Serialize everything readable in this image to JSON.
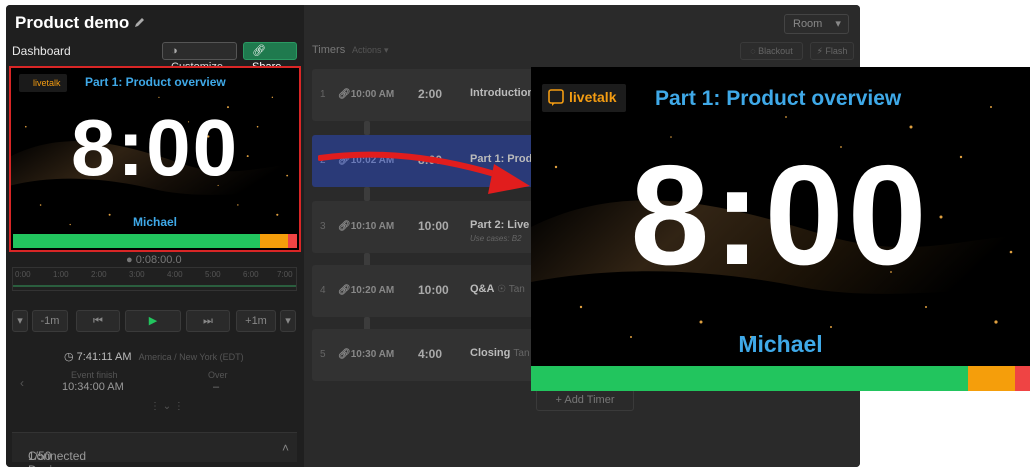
{
  "app": {
    "title": "Product demo",
    "dashboard_label": "Dashboard",
    "customize_label": "Customize",
    "share_label": "Share",
    "room_label": "Room",
    "timers_label": "Timers",
    "actions_label": "Actions",
    "blackout_label": "Blackout",
    "flash_label": "Flash",
    "add_timer_label": "+ Add Timer"
  },
  "preview": {
    "logo_text": "livetalk",
    "segment_title": "Part 1: Product overview",
    "time": "8:00",
    "speaker": "Michael",
    "progress": {
      "green": 0.87,
      "orange": 0.1,
      "red": 0.03
    }
  },
  "transport": {
    "elapsed": "0:08:00.0",
    "timeline_ticks": [
      "0:00",
      "1:00",
      "2:00",
      "3:00",
      "4:00",
      "5:00",
      "6:00",
      "7:00"
    ],
    "minus_label": "-1m",
    "plus_label": "+1m"
  },
  "clock": {
    "time": "7:41:11 AM",
    "timezone": "America / New York (EDT)",
    "event_finish_label": "Event finish",
    "event_finish_value": "10:34:00 AM",
    "over_label": "Over",
    "over_value": "–"
  },
  "devices": {
    "label": "Connected Devices",
    "count": "1/50"
  },
  "timers": [
    {
      "num": "1",
      "start": "10:00 AM",
      "duration": "2:00",
      "name": "Introduction",
      "speaker": "",
      "sub": "",
      "active": false
    },
    {
      "num": "2",
      "start": "10:02 AM",
      "duration": "8:00",
      "name": "Part 1: Product overview",
      "speaker": "",
      "sub": "",
      "active": true
    },
    {
      "num": "3",
      "start": "10:10 AM",
      "duration": "10:00",
      "name": "Part 2: Live",
      "speaker": "",
      "sub": "Use cases: B2",
      "active": false
    },
    {
      "num": "4",
      "start": "10:20 AM",
      "duration": "10:00",
      "name": "Q&A",
      "speaker": "Tan",
      "sub": "",
      "active": false
    },
    {
      "num": "5",
      "start": "10:30 AM",
      "duration": "4:00",
      "name": "Closing",
      "speaker": "Tan",
      "sub": "",
      "active": false
    }
  ],
  "fullscreen": {
    "logo_text": "livetalk",
    "segment_title": "Part 1: Product overview",
    "time": "8:00",
    "speaker": "Michael"
  },
  "colors": {
    "accent": "#3fa9e8",
    "green": "#22c55e",
    "orange": "#f59e0b",
    "red": "#ef4444",
    "arrow": "#e11d1d"
  }
}
